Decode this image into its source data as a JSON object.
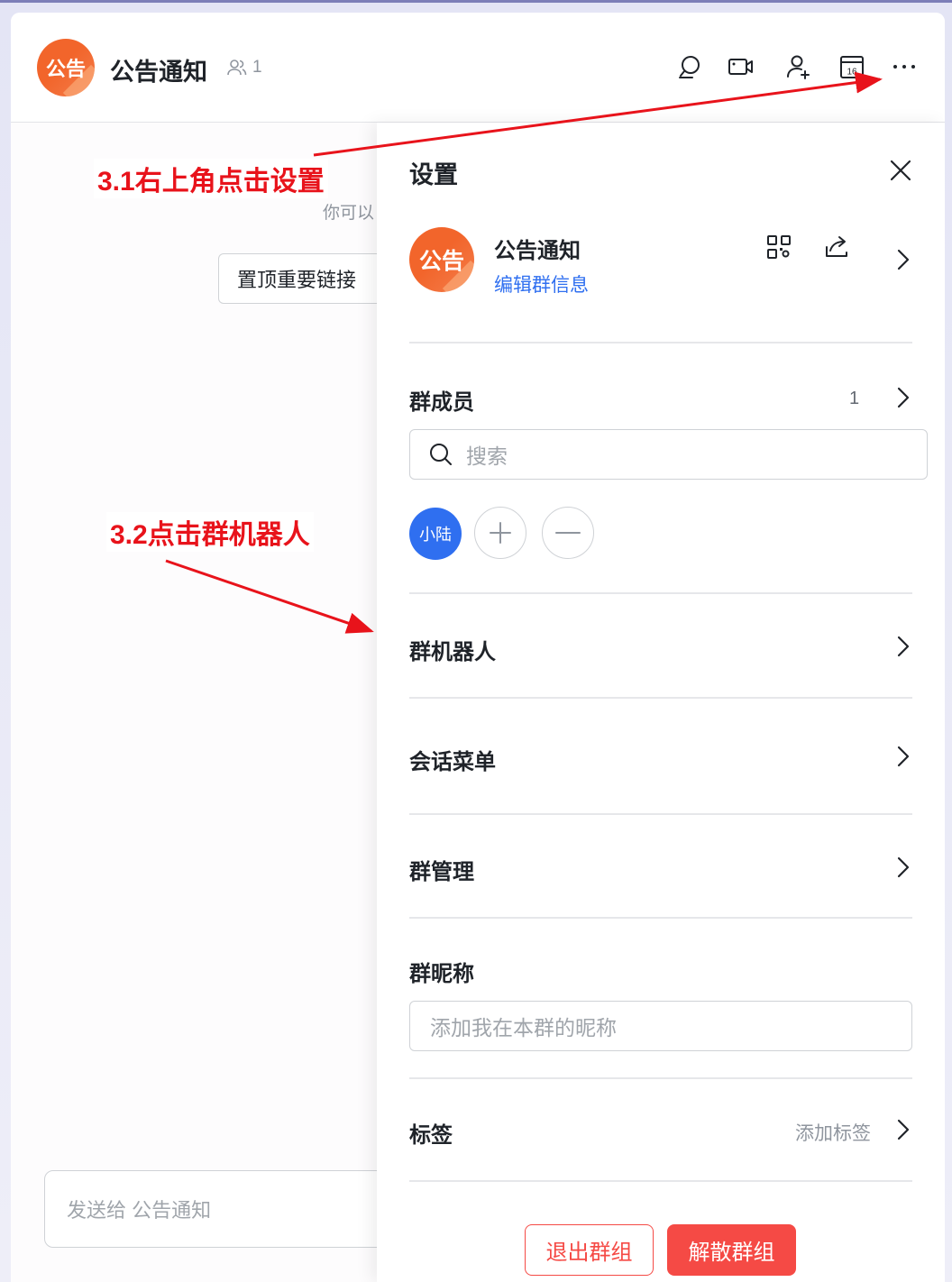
{
  "header": {
    "avatar_text": "公告",
    "title": "公告通知",
    "member_count": "1",
    "icons": [
      "search-icon",
      "video-call-icon",
      "add-member-icon",
      "calendar-icon",
      "more-icon"
    ],
    "calendar_day": "16"
  },
  "chat": {
    "hint": "你可以",
    "pin_link": "置顶重要链接",
    "composer_placeholder": "发送给 公告通知"
  },
  "settings": {
    "title": "设置",
    "group_avatar_text": "公告",
    "group_name": "公告通知",
    "edit_info": "编辑群信息",
    "members_label": "群成员",
    "members_count": "1",
    "search_placeholder": "搜索",
    "member_name": "小陆",
    "robots_label": "群机器人",
    "menu_label": "会话菜单",
    "manage_label": "群管理",
    "nickname_label": "群昵称",
    "nickname_placeholder": "添加我在本群的昵称",
    "tags_label": "标签",
    "add_tag": "添加标签",
    "exit_button": "退出群组",
    "dissolve_button": "解散群组"
  },
  "annotations": {
    "step1": "3.1右上角点击设置",
    "step2": "3.2点击群机器人"
  },
  "colors": {
    "accent_blue": "#2f6ff0",
    "danger_red": "#f54a45",
    "annotation_red": "#e8131b",
    "avatar_orange": "#f2652b"
  }
}
